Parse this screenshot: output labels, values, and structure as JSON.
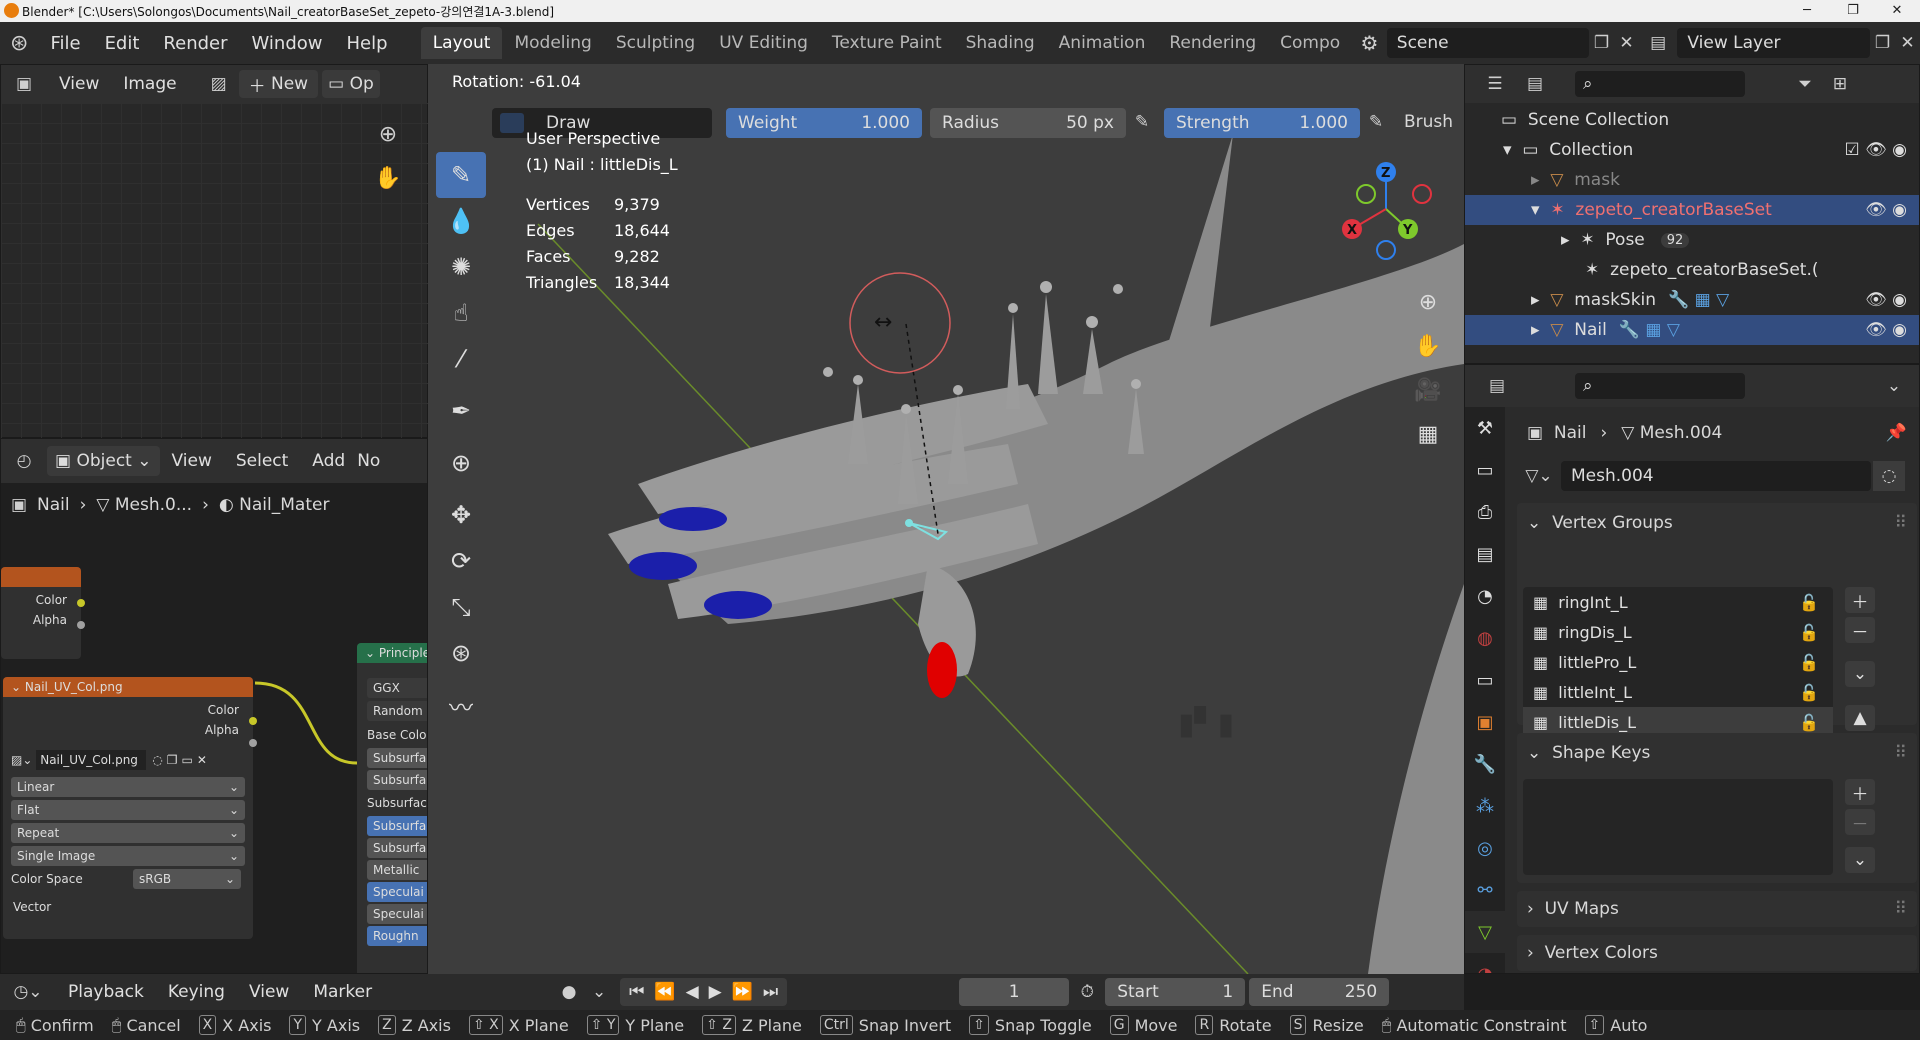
{
  "window": {
    "title": "Blender* [C:\\Users\\Solongos\\Documents\\Nail_creatorBaseSet_zepeto-강의연결1A-3.blend]",
    "minimize": "─",
    "maximize": "❐",
    "close": "✕"
  },
  "menu": [
    "File",
    "Edit",
    "Render",
    "Window",
    "Help"
  ],
  "workspaces": [
    "Layout",
    "Modeling",
    "Sculpting",
    "UV Editing",
    "Texture Paint",
    "Shading",
    "Animation",
    "Rendering",
    "Compo"
  ],
  "scene": {
    "name": "Scene",
    "view_layer": "View Layer"
  },
  "image_editor": {
    "view": "View",
    "image": "Image",
    "new": "New",
    "open": "Op"
  },
  "node_editor": {
    "mode": "Object",
    "view": "View",
    "select": "Select",
    "add": "Add",
    "more": "No",
    "breadcrumb": [
      "Nail",
      "Mesh.0...",
      "Nail_Mater"
    ],
    "frame_node": {
      "outputs": [
        "Color",
        "Alpha"
      ]
    },
    "image_node": {
      "title": "Nail_UV_Col.png",
      "outputs": [
        "Color",
        "Alpha"
      ],
      "image": "Nail_UV_Col.png",
      "interpolation": "Linear",
      "projection": "Flat",
      "extension": "Repeat",
      "source": "Single Image",
      "colorspace_label": "Color Space",
      "colorspace": "sRGB",
      "vector": "Vector"
    },
    "principled": {
      "title": "Principle",
      "fields": [
        "GGX",
        "Random",
        "Base Colo",
        "Subsurfa",
        "Subsurfa",
        "Subsurfac",
        "Subsurfa",
        "Subsurfa",
        "Metallic",
        "Speculai",
        "Speculai",
        "Roughn"
      ]
    }
  },
  "viewport": {
    "rotation": "Rotation: -61.04",
    "brush_mode": "Draw",
    "weight_label": "Weight",
    "weight": "1.000",
    "radius_label": "Radius",
    "radius": "50 px",
    "strength_label": "Strength",
    "strength": "1.000",
    "brush": "Brush",
    "perspective": "User Perspective",
    "object": "(1) Nail : littleDis_L",
    "stats": [
      {
        "k": "Vertices",
        "v": "9,379"
      },
      {
        "k": "Edges",
        "v": "18,644"
      },
      {
        "k": "Faces",
        "v": "9,282"
      },
      {
        "k": "Triangles",
        "v": "18,344"
      }
    ],
    "gizmo": {
      "x": "X",
      "y": "Y",
      "z": "Z"
    },
    "colors": {
      "x": "#e0333f",
      "y": "#7ec92c",
      "z": "#2f80ed",
      "nail_blue": "#1b1faa",
      "nail_red": "#e00000",
      "skin": "#8a8a8a"
    }
  },
  "outliner": {
    "items": [
      {
        "label": "Scene Collection",
        "level": 0
      },
      {
        "label": "Collection",
        "level": 1
      },
      {
        "label": "mask",
        "level": 2
      },
      {
        "label": "zepeto_creatorBaseSet",
        "level": 2
      },
      {
        "label": "Pose",
        "level": 3,
        "badge": "92"
      },
      {
        "label": "zepeto_creatorBaseSet.(",
        "level": 3
      },
      {
        "label": "maskSkin",
        "level": 2
      },
      {
        "label": "Nail",
        "level": 2
      }
    ]
  },
  "properties": {
    "breadcrumb": [
      "Nail",
      "Mesh.004"
    ],
    "mesh_name": "Mesh.004",
    "vertex_groups_title": "Vertex Groups",
    "vertex_groups": [
      "ringInt_L",
      "ringDis_L",
      "littlePro_L",
      "littleInt_L",
      "littleDis_L"
    ],
    "shape_keys_title": "Shape Keys",
    "uv_maps_title": "UV Maps",
    "vertex_colors_title": "Vertex Colors"
  },
  "timeline": {
    "playback": "Playback",
    "keying": "Keying",
    "view": "View",
    "marker": "Marker",
    "frame": "1",
    "start_label": "Start",
    "start": "1",
    "end_label": "End",
    "end": "250"
  },
  "statusbar": [
    {
      "key": "",
      "label": "Confirm"
    },
    {
      "key": "",
      "label": "Cancel"
    },
    {
      "key": "X",
      "label": "X Axis"
    },
    {
      "key": "Y",
      "label": "Y Axis"
    },
    {
      "key": "Z",
      "label": "Z Axis"
    },
    {
      "key": "⇧ X",
      "label": "X Plane"
    },
    {
      "key": "⇧ Y",
      "label": "Y Plane"
    },
    {
      "key": "⇧ Z",
      "label": "Z Plane"
    },
    {
      "key": "Ctrl",
      "label": "Snap Invert"
    },
    {
      "key": "⇧",
      "label": "Snap Toggle"
    },
    {
      "key": "G",
      "label": "Move"
    },
    {
      "key": "R",
      "label": "Rotate"
    },
    {
      "key": "S",
      "label": "Resize"
    },
    {
      "key": "",
      "label": "Automatic Constraint"
    },
    {
      "key": "⇧",
      "label": "Auto"
    }
  ]
}
